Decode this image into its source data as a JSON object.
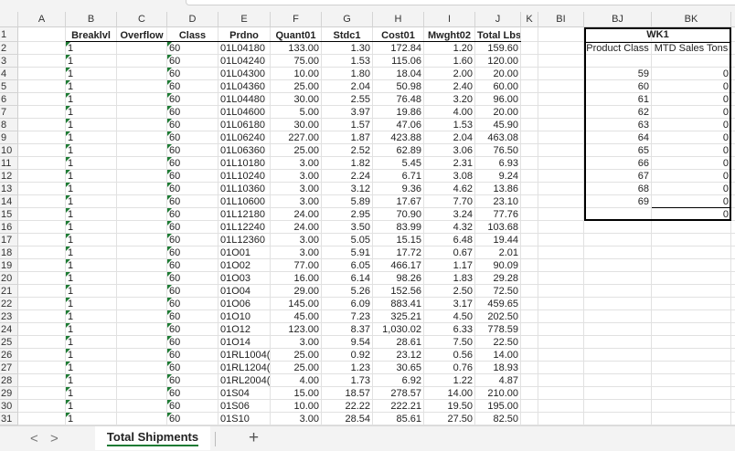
{
  "sheet": {
    "column_letters": [
      "A",
      "B",
      "C",
      "D",
      "E",
      "F",
      "G",
      "H",
      "I",
      "J",
      "K",
      "BI",
      "BJ",
      "BK"
    ],
    "row_numbers": [
      "1",
      "2",
      "3",
      "4",
      "5",
      "6",
      "7",
      "8",
      "9",
      "10",
      "11",
      "12",
      "13",
      "14",
      "15",
      "16",
      "17",
      "18",
      "19",
      "20",
      "21",
      "22",
      "23",
      "24",
      "25",
      "26",
      "27",
      "28",
      "29",
      "30",
      "31"
    ],
    "headers": [
      "Breaklvl",
      "Overflow",
      "Class",
      "Prdno",
      "Quant01",
      "Stdc1",
      "Cost01",
      "Mwght02",
      "Total Lbs"
    ],
    "rows": [
      [
        "1",
        "",
        "60",
        "01L04180",
        "133.00",
        "1.30",
        "172.84",
        "1.20",
        "159.60"
      ],
      [
        "1",
        "",
        "60",
        "01L04240",
        "75.00",
        "1.53",
        "115.06",
        "1.60",
        "120.00"
      ],
      [
        "1",
        "",
        "60",
        "01L04300",
        "10.00",
        "1.80",
        "18.04",
        "2.00",
        "20.00"
      ],
      [
        "1",
        "",
        "60",
        "01L04360",
        "25.00",
        "2.04",
        "50.98",
        "2.40",
        "60.00"
      ],
      [
        "1",
        "",
        "60",
        "01L04480",
        "30.00",
        "2.55",
        "76.48",
        "3.20",
        "96.00"
      ],
      [
        "1",
        "",
        "60",
        "01L04600",
        "5.00",
        "3.97",
        "19.86",
        "4.00",
        "20.00"
      ],
      [
        "1",
        "",
        "60",
        "01L06180",
        "30.00",
        "1.57",
        "47.06",
        "1.53",
        "45.90"
      ],
      [
        "1",
        "",
        "60",
        "01L06240",
        "227.00",
        "1.87",
        "423.88",
        "2.04",
        "463.08"
      ],
      [
        "1",
        "",
        "60",
        "01L06360",
        "25.00",
        "2.52",
        "62.89",
        "3.06",
        "76.50"
      ],
      [
        "1",
        "",
        "60",
        "01L10180",
        "3.00",
        "1.82",
        "5.45",
        "2.31",
        "6.93"
      ],
      [
        "1",
        "",
        "60",
        "01L10240",
        "3.00",
        "2.24",
        "6.71",
        "3.08",
        "9.24"
      ],
      [
        "1",
        "",
        "60",
        "01L10360",
        "3.00",
        "3.12",
        "9.36",
        "4.62",
        "13.86"
      ],
      [
        "1",
        "",
        "60",
        "01L10600",
        "3.00",
        "5.89",
        "17.67",
        "7.70",
        "23.10"
      ],
      [
        "1",
        "",
        "60",
        "01L12180",
        "24.00",
        "2.95",
        "70.90",
        "3.24",
        "77.76"
      ],
      [
        "1",
        "",
        "60",
        "01L12240",
        "24.00",
        "3.50",
        "83.99",
        "4.32",
        "103.68"
      ],
      [
        "1",
        "",
        "60",
        "01L12360",
        "3.00",
        "5.05",
        "15.15",
        "6.48",
        "19.44"
      ],
      [
        "1",
        "",
        "60",
        "01O01",
        "3.00",
        "5.91",
        "17.72",
        "0.67",
        "2.01"
      ],
      [
        "1",
        "",
        "60",
        "01O02",
        "77.00",
        "6.05",
        "466.17",
        "1.17",
        "90.09"
      ],
      [
        "1",
        "",
        "60",
        "01O03",
        "16.00",
        "6.14",
        "98.26",
        "1.83",
        "29.28"
      ],
      [
        "1",
        "",
        "60",
        "01O04",
        "29.00",
        "5.26",
        "152.56",
        "2.50",
        "72.50"
      ],
      [
        "1",
        "",
        "60",
        "01O06",
        "145.00",
        "6.09",
        "883.41",
        "3.17",
        "459.65"
      ],
      [
        "1",
        "",
        "60",
        "01O10",
        "45.00",
        "7.23",
        "325.21",
        "4.50",
        "202.50"
      ],
      [
        "1",
        "",
        "60",
        "01O12",
        "123.00",
        "8.37",
        "1,030.02",
        "6.33",
        "778.59"
      ],
      [
        "1",
        "",
        "60",
        "01O14",
        "3.00",
        "9.54",
        "28.61",
        "7.50",
        "22.50"
      ],
      [
        "1",
        "",
        "60",
        "01RL1004(",
        "25.00",
        "0.92",
        "23.12",
        "0.56",
        "14.00"
      ],
      [
        "1",
        "",
        "60",
        "01RL1204(",
        "25.00",
        "1.23",
        "30.65",
        "0.76",
        "18.93"
      ],
      [
        "1",
        "",
        "60",
        "01RL2004(",
        "4.00",
        "1.73",
        "6.92",
        "1.22",
        "4.87"
      ],
      [
        "1",
        "",
        "60",
        "01S04",
        "15.00",
        "18.57",
        "278.57",
        "14.00",
        "210.00"
      ],
      [
        "1",
        "",
        "60",
        "01S06",
        "10.00",
        "22.22",
        "222.21",
        "19.50",
        "195.00"
      ],
      [
        "1",
        "",
        "60",
        "01S10",
        "3.00",
        "28.54",
        "85.61",
        "27.50",
        "82.50"
      ]
    ],
    "summary": {
      "title": "WK1",
      "headers": [
        "Product Class",
        "MTD Sales Tons"
      ],
      "rows": [
        [
          "59",
          "0"
        ],
        [
          "60",
          "0"
        ],
        [
          "61",
          "0"
        ],
        [
          "62",
          "0"
        ],
        [
          "63",
          "0"
        ],
        [
          "64",
          "0"
        ],
        [
          "65",
          "0"
        ],
        [
          "66",
          "0"
        ],
        [
          "67",
          "0"
        ],
        [
          "68",
          "0"
        ],
        [
          "69",
          "0"
        ]
      ],
      "total": "0"
    }
  },
  "tabs": {
    "active": "Total Shipments",
    "prev_icon": "chevron-left",
    "next_icon": "chevron-right",
    "add_icon": "plus",
    "add_label": "+",
    "prev_label": "<",
    "next_label": ">"
  },
  "colors": {
    "accent": "#1e7b34"
  }
}
